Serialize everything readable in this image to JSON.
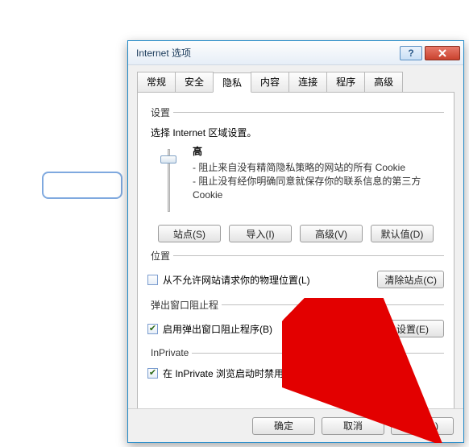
{
  "window": {
    "title": "Internet 选项",
    "help_glyph": "?"
  },
  "tabs": {
    "items": [
      "常规",
      "安全",
      "隐私",
      "内容",
      "连接",
      "程序",
      "高级"
    ],
    "active_index": 2
  },
  "settings": {
    "legend": "设置",
    "intro": "选择 Internet 区域设置。",
    "slider_level": "高",
    "bullets": [
      "- 阻止来自没有精简隐私策略的网站的所有 Cookie",
      "- 阻止没有经你明确同意就保存你的联系信息的第三方 Cookie"
    ],
    "buttons": {
      "sites": "站点(S)",
      "import": "导入(I)",
      "advanced": "高级(V)",
      "default": "默认值(D)"
    }
  },
  "location": {
    "legend": "位置",
    "never_allow": "从不允许网站请求你的物理位置(L)",
    "never_allow_checked": false,
    "clear_sites": "清除站点(C)"
  },
  "popup": {
    "legend": "弹出窗口阻止程",
    "enable": "启用弹出窗口阻止程序(B)",
    "enable_checked": true,
    "settings_btn": "设置(E)"
  },
  "inprivate": {
    "legend": "InPrivate",
    "disable_toolbars": "在 InPrivate 浏览启动时禁用工具栏和扩展(T)",
    "checked": true
  },
  "footer": {
    "ok": "确定",
    "cancel": "取消",
    "apply": "应用(A)"
  }
}
